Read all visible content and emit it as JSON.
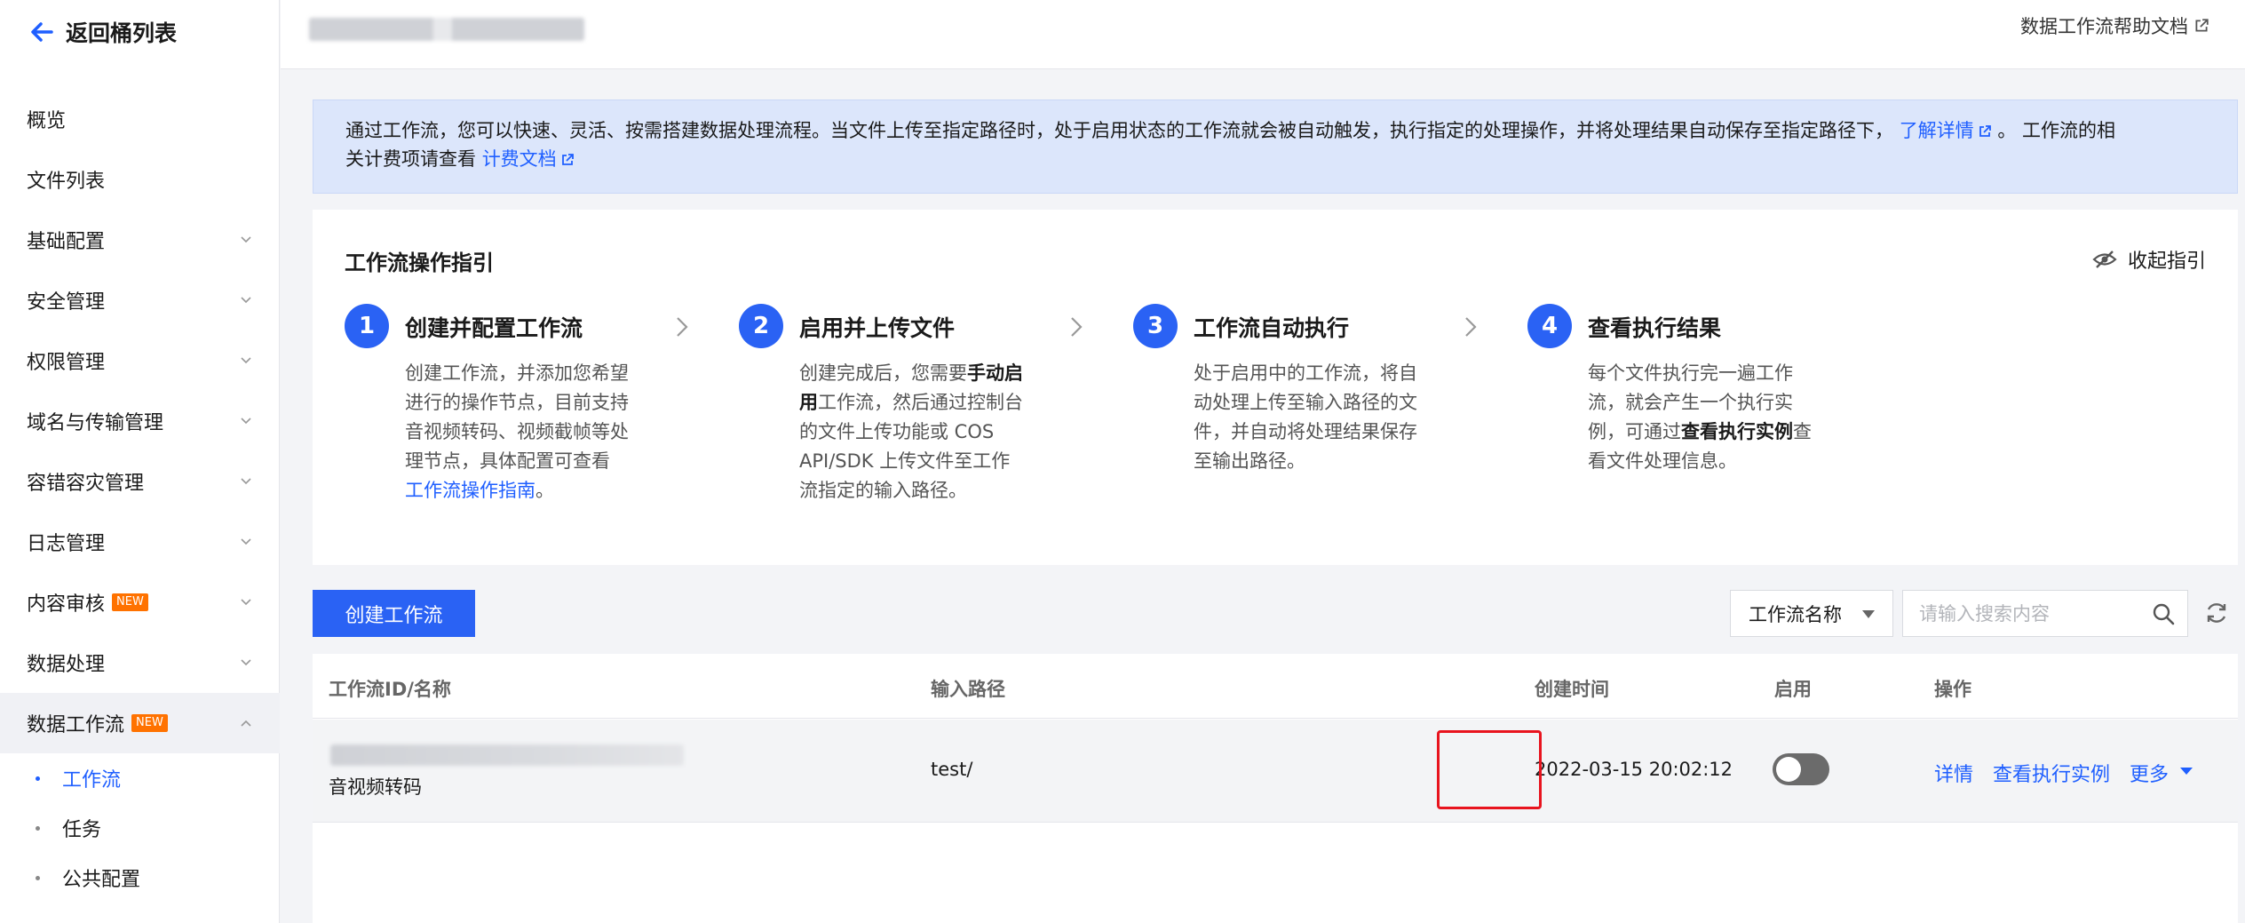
{
  "sidebar": {
    "back_label": "返回桶列表",
    "items": [
      {
        "label": "概览"
      },
      {
        "label": "文件列表"
      },
      {
        "label": "基础配置"
      },
      {
        "label": "安全管理"
      },
      {
        "label": "权限管理"
      },
      {
        "label": "域名与传输管理"
      },
      {
        "label": "容错容灾管理"
      },
      {
        "label": "日志管理"
      },
      {
        "label": "内容审核",
        "badge": "NEW"
      },
      {
        "label": "数据处理"
      },
      {
        "label": "数据工作流",
        "badge": "NEW"
      }
    ],
    "sub_items": [
      {
        "label": "工作流"
      },
      {
        "label": "任务"
      },
      {
        "label": "公共配置"
      }
    ],
    "accent": "#1f5fff",
    "badge_color": "#ff7200"
  },
  "header": {
    "help_link": "数据工作流帮助文档"
  },
  "banner": {
    "text_1": "通过工作流，您可以快速、灵活、按需搭建数据处理流程。当文件上传至指定路径时，处于启用状态的工作流就会被自动触发，执行指定的处理操作，并将处理结果自动保存至指定路径下，",
    "link_1": "了解详情",
    "text_2": "。 工作流的相",
    "text_3": "关计费项请查看",
    "link_2": "计费文档"
  },
  "guide": {
    "title": "工作流操作指引",
    "collapse_label": "收起指引",
    "steps": [
      {
        "num": "1",
        "title": "创建并配置工作流",
        "desc_1": "创建工作流，并添加您希望进行的操作节点，目前支持音视频转码、视频截帧等处理节点，具体配置可查看 ",
        "desc_link": "工作流操作指南",
        "desc_2": "。"
      },
      {
        "num": "2",
        "title": "启用并上传文件",
        "desc_1": "创建完成后，您需要",
        "desc_bold": "手动启用",
        "desc_2": "工作流，然后通过控制台的文件上传功能或 COS API/SDK 上传文件至工作流指定的输入路径。"
      },
      {
        "num": "3",
        "title": "工作流自动执行",
        "desc_1": "处于启用中的工作流，将自动处理上传至输入路径的文件，并自动将处理结果保存至输出路径。"
      },
      {
        "num": "4",
        "title": "查看执行结果",
        "desc_1": "每个文件执行完一遍工作流，就会产生一个执行实例，可通过",
        "desc_bold": "查看执行实例",
        "desc_2": "查看文件处理信息。"
      }
    ]
  },
  "toolbar": {
    "create_label": "创建工作流",
    "filter_selected": "工作流名称",
    "search_placeholder": "请输入搜索内容"
  },
  "table": {
    "columns": [
      "工作流ID/名称",
      "输入路径",
      "创建时间",
      "启用",
      "操作"
    ],
    "rows": [
      {
        "name": "音视频转码",
        "input_path": "test/",
        "created": "2022-03-15 20:02:12",
        "enabled": false,
        "actions": [
          "详情",
          "查看执行实例",
          "更多"
        ]
      }
    ]
  }
}
